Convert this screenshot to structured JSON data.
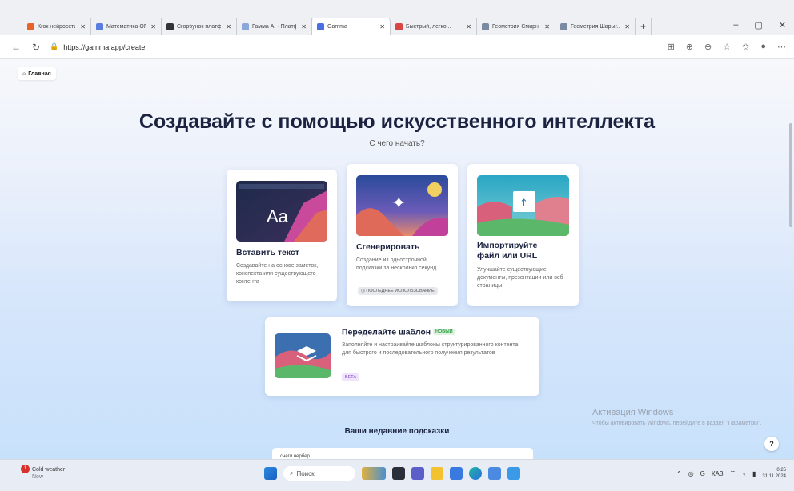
{
  "browser": {
    "tabs": [
      {
        "label": "Кгок нейросеть -",
        "color": "#e8622a"
      },
      {
        "label": "Математика ОГЭ",
        "color": "#5a7de0"
      },
      {
        "label": "Сгорбунок платф...",
        "color": "#333333"
      },
      {
        "label": "Гамма AI - Платф...",
        "color": "#8aa8d8"
      },
      {
        "label": "Gamma",
        "color": "#4a6fe3",
        "active": true
      },
      {
        "label": "Быстрый, легко...",
        "color": "#d94545"
      },
      {
        "label": "Геометрия Смирн...",
        "color": "#7a8aa0"
      },
      {
        "label": "Геометрия Шарыг...",
        "color": "#7a8aa0"
      }
    ],
    "url": "https://gamma.app/create"
  },
  "page": {
    "home_label": "Главная",
    "title": "Создавайте с помощью искусственного интеллекта",
    "subtitle": "С чего начать?",
    "cards": {
      "paste": {
        "title": "Вставить текст",
        "desc": "Создавайте на основе заметок, конспекта или существующего контента",
        "thumb_text": "Aa"
      },
      "generate": {
        "title": "Сгенерировать",
        "desc": "Создание из однострочной подсказки за несколько секунд",
        "badge": "ПОСЛЕДНЕЕ ИСПОЛЬЗОВАНИЕ"
      },
      "import": {
        "title_line1": "Импортируйте",
        "title_line2": "файл или URL",
        "desc": "Улучшайте существующие документы, презентации или веб-страницы."
      },
      "template": {
        "title": "Переделайте шаблон",
        "new_badge": "НОВЫЙ",
        "desc": "Заполняйте и настраивайте шаблоны структурированного контента для быстрого и последовательного получения результатов",
        "beta_badge": "БЕТА"
      }
    },
    "recent_title": "Ваши недавние подсказки",
    "recent_item": "снеги нербер",
    "help_label": "?"
  },
  "watermark": {
    "line1": "Активация Windows",
    "line2": "Чтобы активировать Windows, перейдите в раздел \"Параметры\"."
  },
  "taskbar": {
    "weather_badge": "1",
    "weather": "Cold weather",
    "weather_sub": "Now",
    "search": "Поиск",
    "lang": "КАЗ",
    "time": "0:25",
    "date": "31.11.2024"
  }
}
